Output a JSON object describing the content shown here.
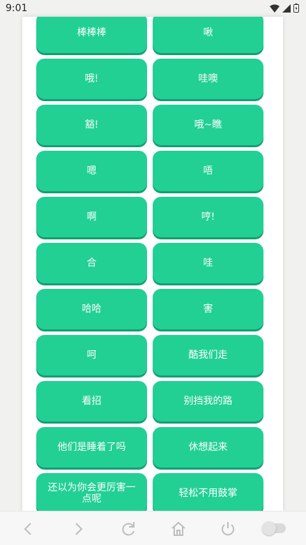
{
  "status_bar": {
    "time": "9:01"
  },
  "buttons": [
    "棒棒棒",
    "啾",
    "哦!",
    "哇噢",
    "豁!",
    "哦~瞧",
    "嗯",
    "唔",
    "啊",
    "哼!",
    "合",
    "哇",
    "哈哈",
    "害",
    "呵",
    "酷我们走",
    "看招",
    "别挡我的路",
    "他们是睡着了吗",
    "休想起来",
    "还以为你会更厉害一点呢",
    "轻松不用鼓掌"
  ],
  "colors": {
    "button": "#22d094",
    "button_shadow": "#139f6f"
  },
  "nav_icons": [
    "back-icon",
    "forward-icon",
    "reload-icon",
    "home-icon",
    "power-icon",
    "toggle-switch"
  ]
}
